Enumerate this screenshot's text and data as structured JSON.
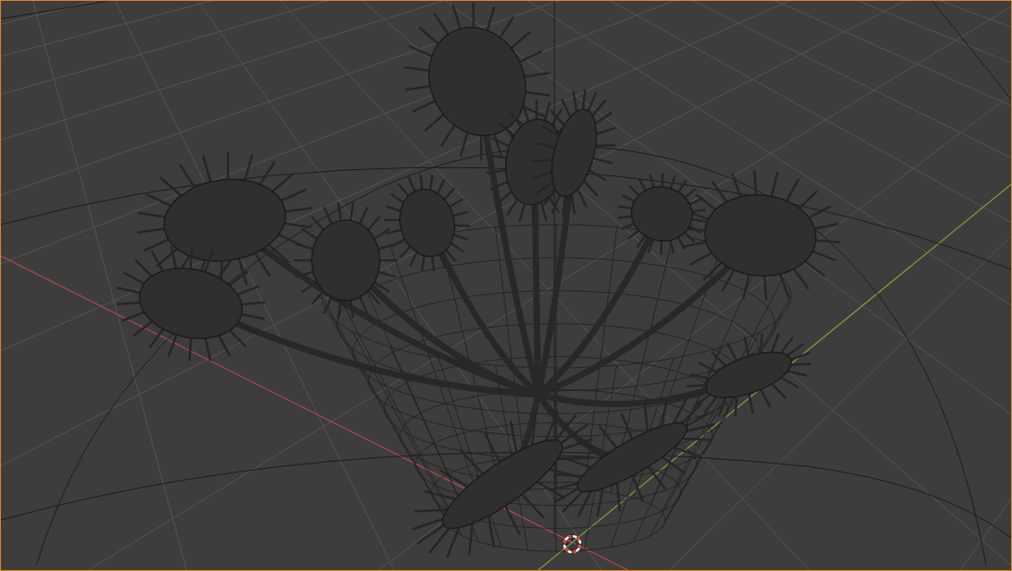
{
  "viewport": {
    "selected": true
  }
}
